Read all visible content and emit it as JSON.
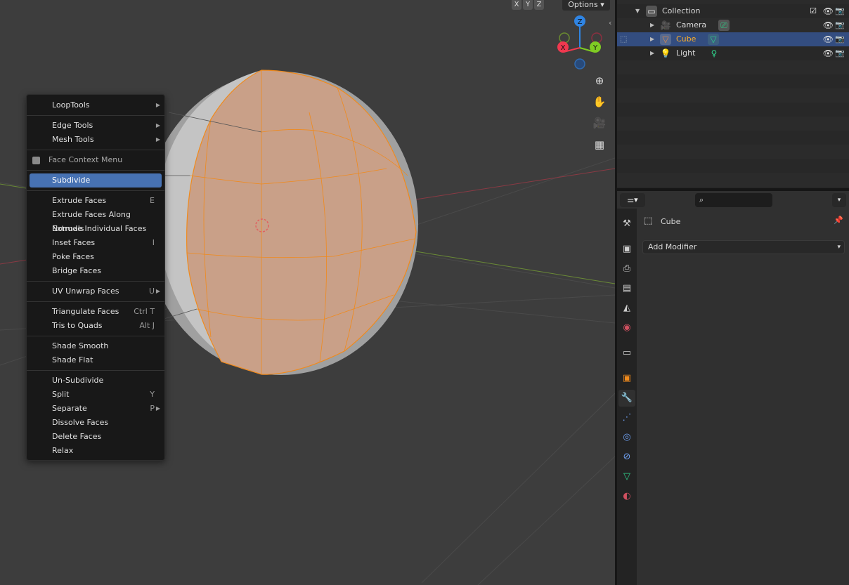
{
  "viewport": {
    "header": {
      "axis_toggles": [
        "X",
        "Y",
        "Z"
      ],
      "options_label": "Options"
    },
    "gizmo": {
      "z": "Z",
      "x": "X",
      "y": "Y",
      "colors": {
        "x": "#f0384f",
        "y": "#7fcb23",
        "z": "#2f84e3"
      }
    },
    "nav_icons": [
      "zoom-icon",
      "hand-pan-icon",
      "camera-view-icon",
      "grid-ortho-icon"
    ],
    "selection_color": "#f08a1c"
  },
  "context_menu": {
    "items": [
      {
        "type": "item",
        "label": "LoopTools",
        "submenu": true
      },
      {
        "type": "sep"
      },
      {
        "type": "item",
        "label": "Edge Tools",
        "submenu": true
      },
      {
        "type": "item",
        "label": "Mesh Tools",
        "submenu": true
      },
      {
        "type": "sep"
      },
      {
        "type": "header",
        "label": "Face Context Menu"
      },
      {
        "type": "sep"
      },
      {
        "type": "item",
        "label": "Subdivide",
        "highlighted": true
      },
      {
        "type": "sep"
      },
      {
        "type": "item",
        "label": "Extrude Faces",
        "shortcut": "E"
      },
      {
        "type": "item",
        "label": "Extrude Faces Along Normals"
      },
      {
        "type": "item",
        "label": "Extrude Individual Faces"
      },
      {
        "type": "item",
        "label": "Inset Faces",
        "shortcut": "I"
      },
      {
        "type": "item",
        "label": "Poke Faces"
      },
      {
        "type": "item",
        "label": "Bridge Faces"
      },
      {
        "type": "sep"
      },
      {
        "type": "item",
        "label": "UV Unwrap Faces",
        "shortcut": "U",
        "submenu": true
      },
      {
        "type": "sep"
      },
      {
        "type": "item",
        "label": "Triangulate Faces",
        "shortcut": "Ctrl T"
      },
      {
        "type": "item",
        "label": "Tris to Quads",
        "shortcut": "Alt J"
      },
      {
        "type": "sep"
      },
      {
        "type": "item",
        "label": "Shade Smooth"
      },
      {
        "type": "item",
        "label": "Shade Flat"
      },
      {
        "type": "sep"
      },
      {
        "type": "item",
        "label": "Un-Subdivide"
      },
      {
        "type": "item",
        "label": "Split",
        "shortcut": "Y"
      },
      {
        "type": "item",
        "label": "Separate",
        "shortcut": "P",
        "submenu": true
      },
      {
        "type": "item",
        "label": "Dissolve Faces"
      },
      {
        "type": "item",
        "label": "Delete Faces"
      },
      {
        "type": "item",
        "label": "Relax"
      }
    ]
  },
  "outliner": {
    "rows": [
      {
        "label": "Collection",
        "kind": "collection",
        "icon": "collection-icon"
      },
      {
        "label": "Camera",
        "kind": "object",
        "icon": "camera-object-icon",
        "data_icon": "camera-data-icon"
      },
      {
        "label": "Cube",
        "kind": "object",
        "icon": "mesh-object-icon",
        "data_icon": "mesh-data-icon",
        "selected": true,
        "color": "#ffaf29"
      },
      {
        "label": "Light",
        "kind": "object",
        "icon": "light-object-icon",
        "data_icon": "light-data-icon"
      }
    ]
  },
  "properties": {
    "object_name": "Cube",
    "add_modifier_label": "Add Modifier",
    "search_placeholder": "",
    "tabs": [
      {
        "name": "tool",
        "glyph": "⚒",
        "color": "#cfcfcf"
      },
      {
        "name": "render",
        "glyph": "▣",
        "color": "#cfcfcf"
      },
      {
        "name": "output",
        "glyph": "⎙",
        "color": "#cfcfcf"
      },
      {
        "name": "view-layer",
        "glyph": "▤",
        "color": "#cfcfcf"
      },
      {
        "name": "scene",
        "glyph": "◭",
        "color": "#cfcfcf"
      },
      {
        "name": "world",
        "glyph": "◉",
        "color": "#d05060"
      },
      {
        "name": "collection",
        "glyph": "▭",
        "color": "#cfcfcf"
      },
      {
        "name": "object",
        "glyph": "▣",
        "color": "#f08a1c"
      },
      {
        "name": "modifiers",
        "glyph": "🔧",
        "color": "#6e9ff0",
        "active": true
      },
      {
        "name": "particles",
        "glyph": "⋰",
        "color": "#6e9ff0"
      },
      {
        "name": "physics",
        "glyph": "◎",
        "color": "#6e9ff0"
      },
      {
        "name": "constraints",
        "glyph": "⊘",
        "color": "#6e9ff0"
      },
      {
        "name": "data",
        "glyph": "▽",
        "color": "#2fd08a"
      },
      {
        "name": "material",
        "glyph": "◐",
        "color": "#d05060"
      }
    ]
  }
}
